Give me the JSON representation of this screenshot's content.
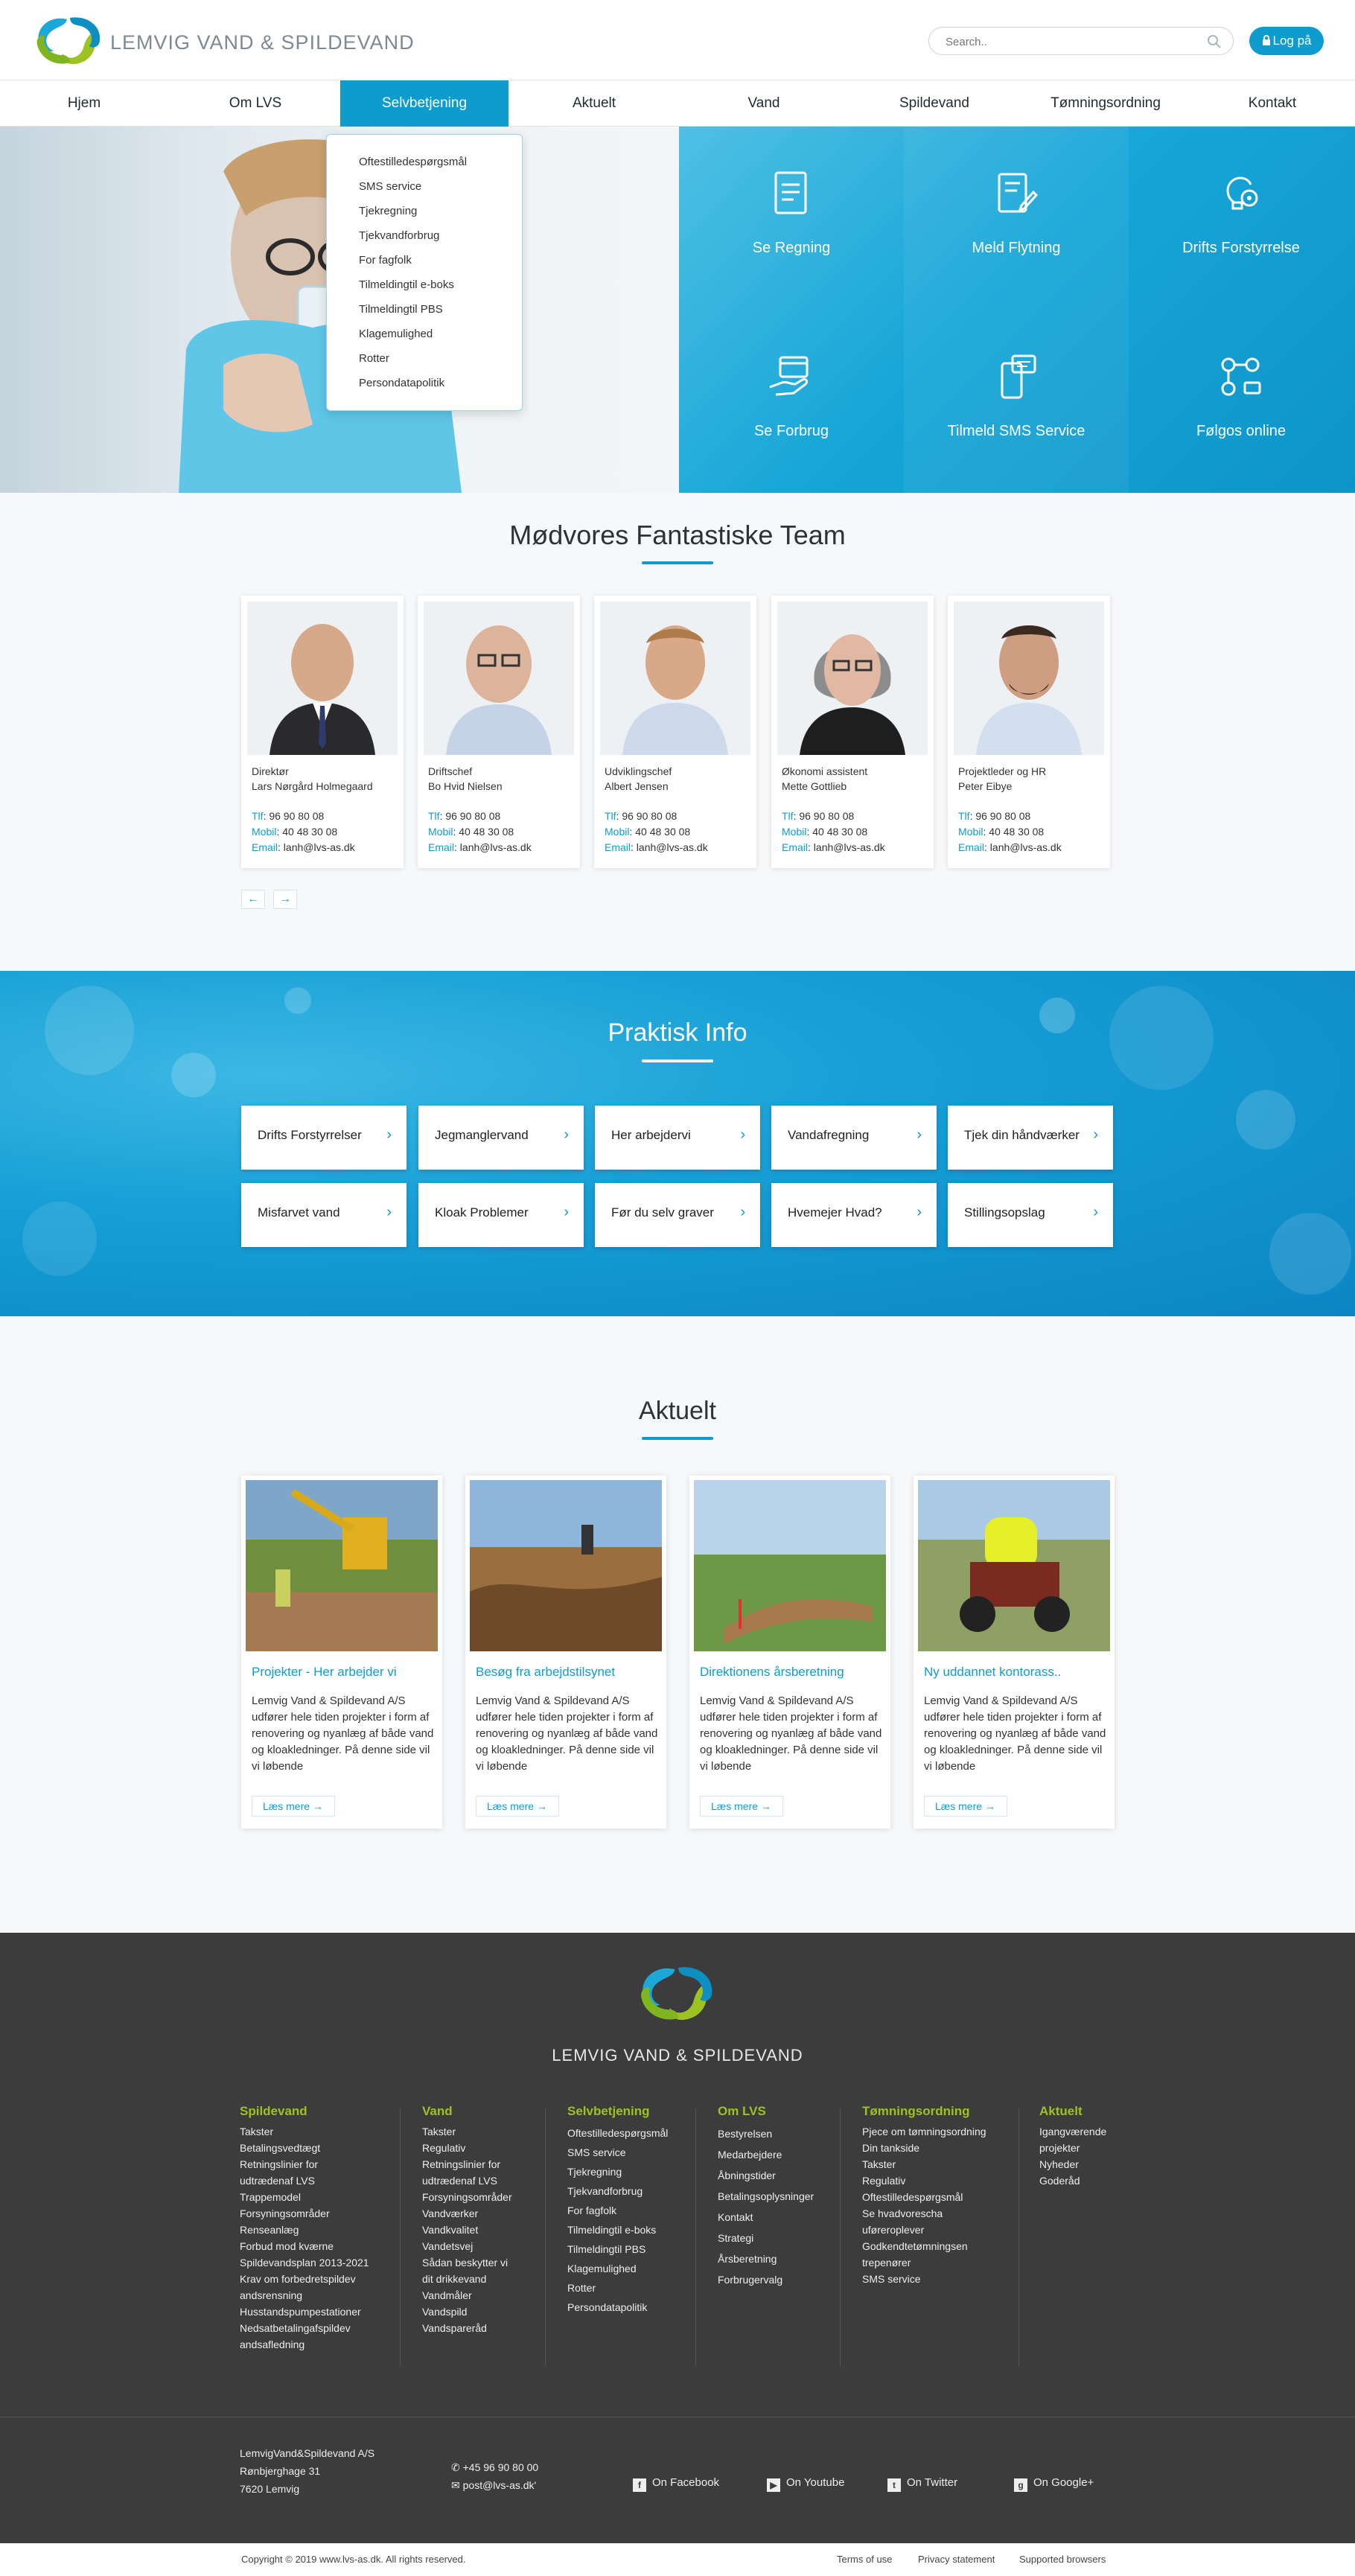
{
  "header": {
    "brand": "LEMVIG VAND & SPILDEVAND",
    "search_placeholder": "Search..",
    "login_label": "Log på"
  },
  "nav": {
    "items": [
      "Hjem",
      "Om LVS",
      "Selvbetjening",
      "Aktuelt",
      "Vand",
      "Spildevand",
      "Tømningsordning",
      "Kontakt"
    ],
    "active": "Selvbetjening"
  },
  "dropdown": {
    "items": [
      "Oftestilledespørgsmål",
      "SMS service",
      "Tjekregning",
      "Tjekvandforbrug",
      "For fagfolk",
      "Tilmeldingtil e-boks",
      "Tilmeldingtil PBS",
      "Klagemulighed",
      "Rotter",
      "Persondatapolitik"
    ]
  },
  "tiles": [
    {
      "label": "Se Regning",
      "icon": "invoice-icon"
    },
    {
      "label": "Meld Flytning",
      "icon": "document-pen-icon"
    },
    {
      "label": "Drifts Forstyrrelse",
      "icon": "lightbulb-gear-icon"
    },
    {
      "label": "Se Forbrug",
      "icon": "card-hand-icon"
    },
    {
      "label": "Tilmeld SMS Service",
      "icon": "phone-sms-icon"
    },
    {
      "label": "Følgos online",
      "icon": "social-share-icon"
    }
  ],
  "team": {
    "title": "Mødvores Fantastiske Team",
    "members": [
      {
        "role": "Direktør",
        "name": "Lars Nørgård Holmegaard",
        "tlf_label": "Tlf",
        "tlf": ": 96 90 80 08",
        "mobil_label": "Mobil",
        "mobil": ": 40 48 30 08",
        "email_label": "Email",
        "email": ": lanh@lvs-as.dk"
      },
      {
        "role": "Driftschef",
        "name": "Bo Hvid Nielsen",
        "tlf_label": "Tlf",
        "tlf": ": 96 90 80 08",
        "mobil_label": "Mobil",
        "mobil": ": 40 48 30 08",
        "email_label": "Email",
        "email": ": lanh@lvs-as.dk"
      },
      {
        "role": "Udviklingschef",
        "name": "Albert Jensen",
        "tlf_label": "Tlf",
        "tlf": ": 96 90 80 08",
        "mobil_label": "Mobil",
        "mobil": ": 40 48 30 08",
        "email_label": "Email",
        "email": ": lanh@lvs-as.dk"
      },
      {
        "role": "Økonomi assistent",
        "name": "Mette Gottlieb",
        "tlf_label": "Tlf",
        "tlf": ": 96 90 80 08",
        "mobil_label": "Mobil",
        "mobil": ": 40 48 30 08",
        "email_label": "Email",
        "email": ": lanh@lvs-as.dk"
      },
      {
        "role": "Projektleder og HR",
        "name": "Peter Eibye",
        "tlf_label": "Tlf",
        "tlf": ": 96 90 80 08",
        "mobil_label": "Mobil",
        "mobil": ": 40 48 30 08",
        "email_label": "Email",
        "email": ": lanh@lvs-as.dk"
      }
    ],
    "prev": "←",
    "next": "→"
  },
  "praktisk": {
    "title": "Praktisk Info",
    "items": [
      "Drifts Forstyrrelser",
      "Jegmanglervand",
      "Her arbejdervi",
      "Vandafregning",
      "Tjek din håndværker",
      "Misfarvet vand",
      "Kloak Problemer",
      "Før du selv graver",
      "Hvemejer Hvad?",
      "Stillingsopslag"
    ]
  },
  "aktuelt": {
    "title": "Aktuelt",
    "news": [
      {
        "title": "Projekter - Her arbejder vi",
        "text": "Lemvig Vand & Spildevand A/S udfører hele tiden projekter i form af renovering og nyanlæg af både vand og kloakledninger. På denne side vil vi løbende",
        "more": "Læs mere"
      },
      {
        "title": "Besøg fra arbejdstilsynet",
        "text": "Lemvig Vand & Spildevand A/S udfører hele tiden projekter i form af renovering og nyanlæg af både vand og kloakledninger. På denne side vil vi løbende",
        "more": "Læs mere"
      },
      {
        "title": "Direktionens årsberetning",
        "text": "Lemvig Vand & Spildevand A/S udfører hele tiden projekter i form af renovering og nyanlæg af både vand og kloakledninger. På denne side vil vi løbende",
        "more": "Læs mere"
      },
      {
        "title": "Ny uddannet kontorass..",
        "text": "Lemvig Vand & Spildevand A/S udfører hele tiden projekter i form af renovering og nyanlæg af både vand og kloakledninger. På denne side vil vi løbende",
        "more": "Læs mere"
      }
    ]
  },
  "footer": {
    "brand": "LEMVIG VAND & SPILDEVAND",
    "columns": [
      {
        "heading": "Spildevand",
        "items": [
          "Takster",
          "Betalingsvedtægt",
          "Retningslinier for",
          "udtrædenaf LVS",
          "Trappemodel",
          "Forsyningsområder",
          "Renseanlæg",
          "Forbud mod kværne",
          "Spildevandsplan 2013-2021",
          "Krav om forbedretspildev",
          "andsrensning",
          "Husstandspumpestationer",
          "Nedsatbetalingafspildev",
          "andsafledning"
        ]
      },
      {
        "heading": "Vand",
        "items": [
          "Takster",
          "Regulativ",
          "Retningslinier for",
          "udtrædenaf LVS",
          "Forsyningsområder",
          "Vandværker",
          "Vandkvalitet",
          "Vandetsvej",
          "Sådan beskytter vi",
          "dit drikkevand",
          "Vandmåler",
          "Vandspild",
          "Vandspareråd"
        ]
      },
      {
        "heading": "Selvbetjening",
        "items": [
          "Oftestilledespørgsmål",
          "SMS service",
          "Tjekregning",
          "Tjekvandforbrug",
          "For fagfolk",
          "Tilmeldingtil e-boks",
          "Tilmeldingtil PBS",
          "Klagemulighed",
          "Rotter",
          "Persondatapolitik"
        ]
      },
      {
        "heading": "Om LVS",
        "items": [
          "Bestyrelsen",
          "Medarbejdere",
          "Åbningstider",
          "Betalingsoplysninger",
          "Kontakt",
          "Strategi",
          "Årsberetning",
          "Forbrugervalg"
        ]
      },
      {
        "heading": "Tømningsordning",
        "items": [
          "Pjece om tømningsordning",
          "Din tankside",
          "Takster",
          "Regulativ",
          "Oftestilledespørgsmål",
          "Se hvadvorescha",
          "uføreroplever",
          "Godkendtetømningsen",
          "trepenører",
          "SMS service"
        ]
      },
      {
        "heading": "Aktuelt",
        "items": [
          "Igangværende",
          "projekter",
          "Nyheder",
          "Goderåd"
        ]
      }
    ],
    "company": "LemvigVand&Spildevand A/S",
    "street": "Rønbjerghage 31",
    "city": "7620 Lemvig",
    "phone": "+45 96 90 80 00",
    "email": "post@lvs-as.dk'",
    "social": [
      "On Facebook",
      "On Youtube",
      "On Twitter",
      "On Google+"
    ],
    "copyright": "Copyright © 2019  www.lvs-as.dk.   All rights reserved.",
    "links": [
      "Terms of use",
      "Privacy statement",
      "Supported browsers"
    ]
  },
  "colors": {
    "accent": "#0e9ccf",
    "green": "#9cc321",
    "footer_bg": "#3c3c3c"
  }
}
